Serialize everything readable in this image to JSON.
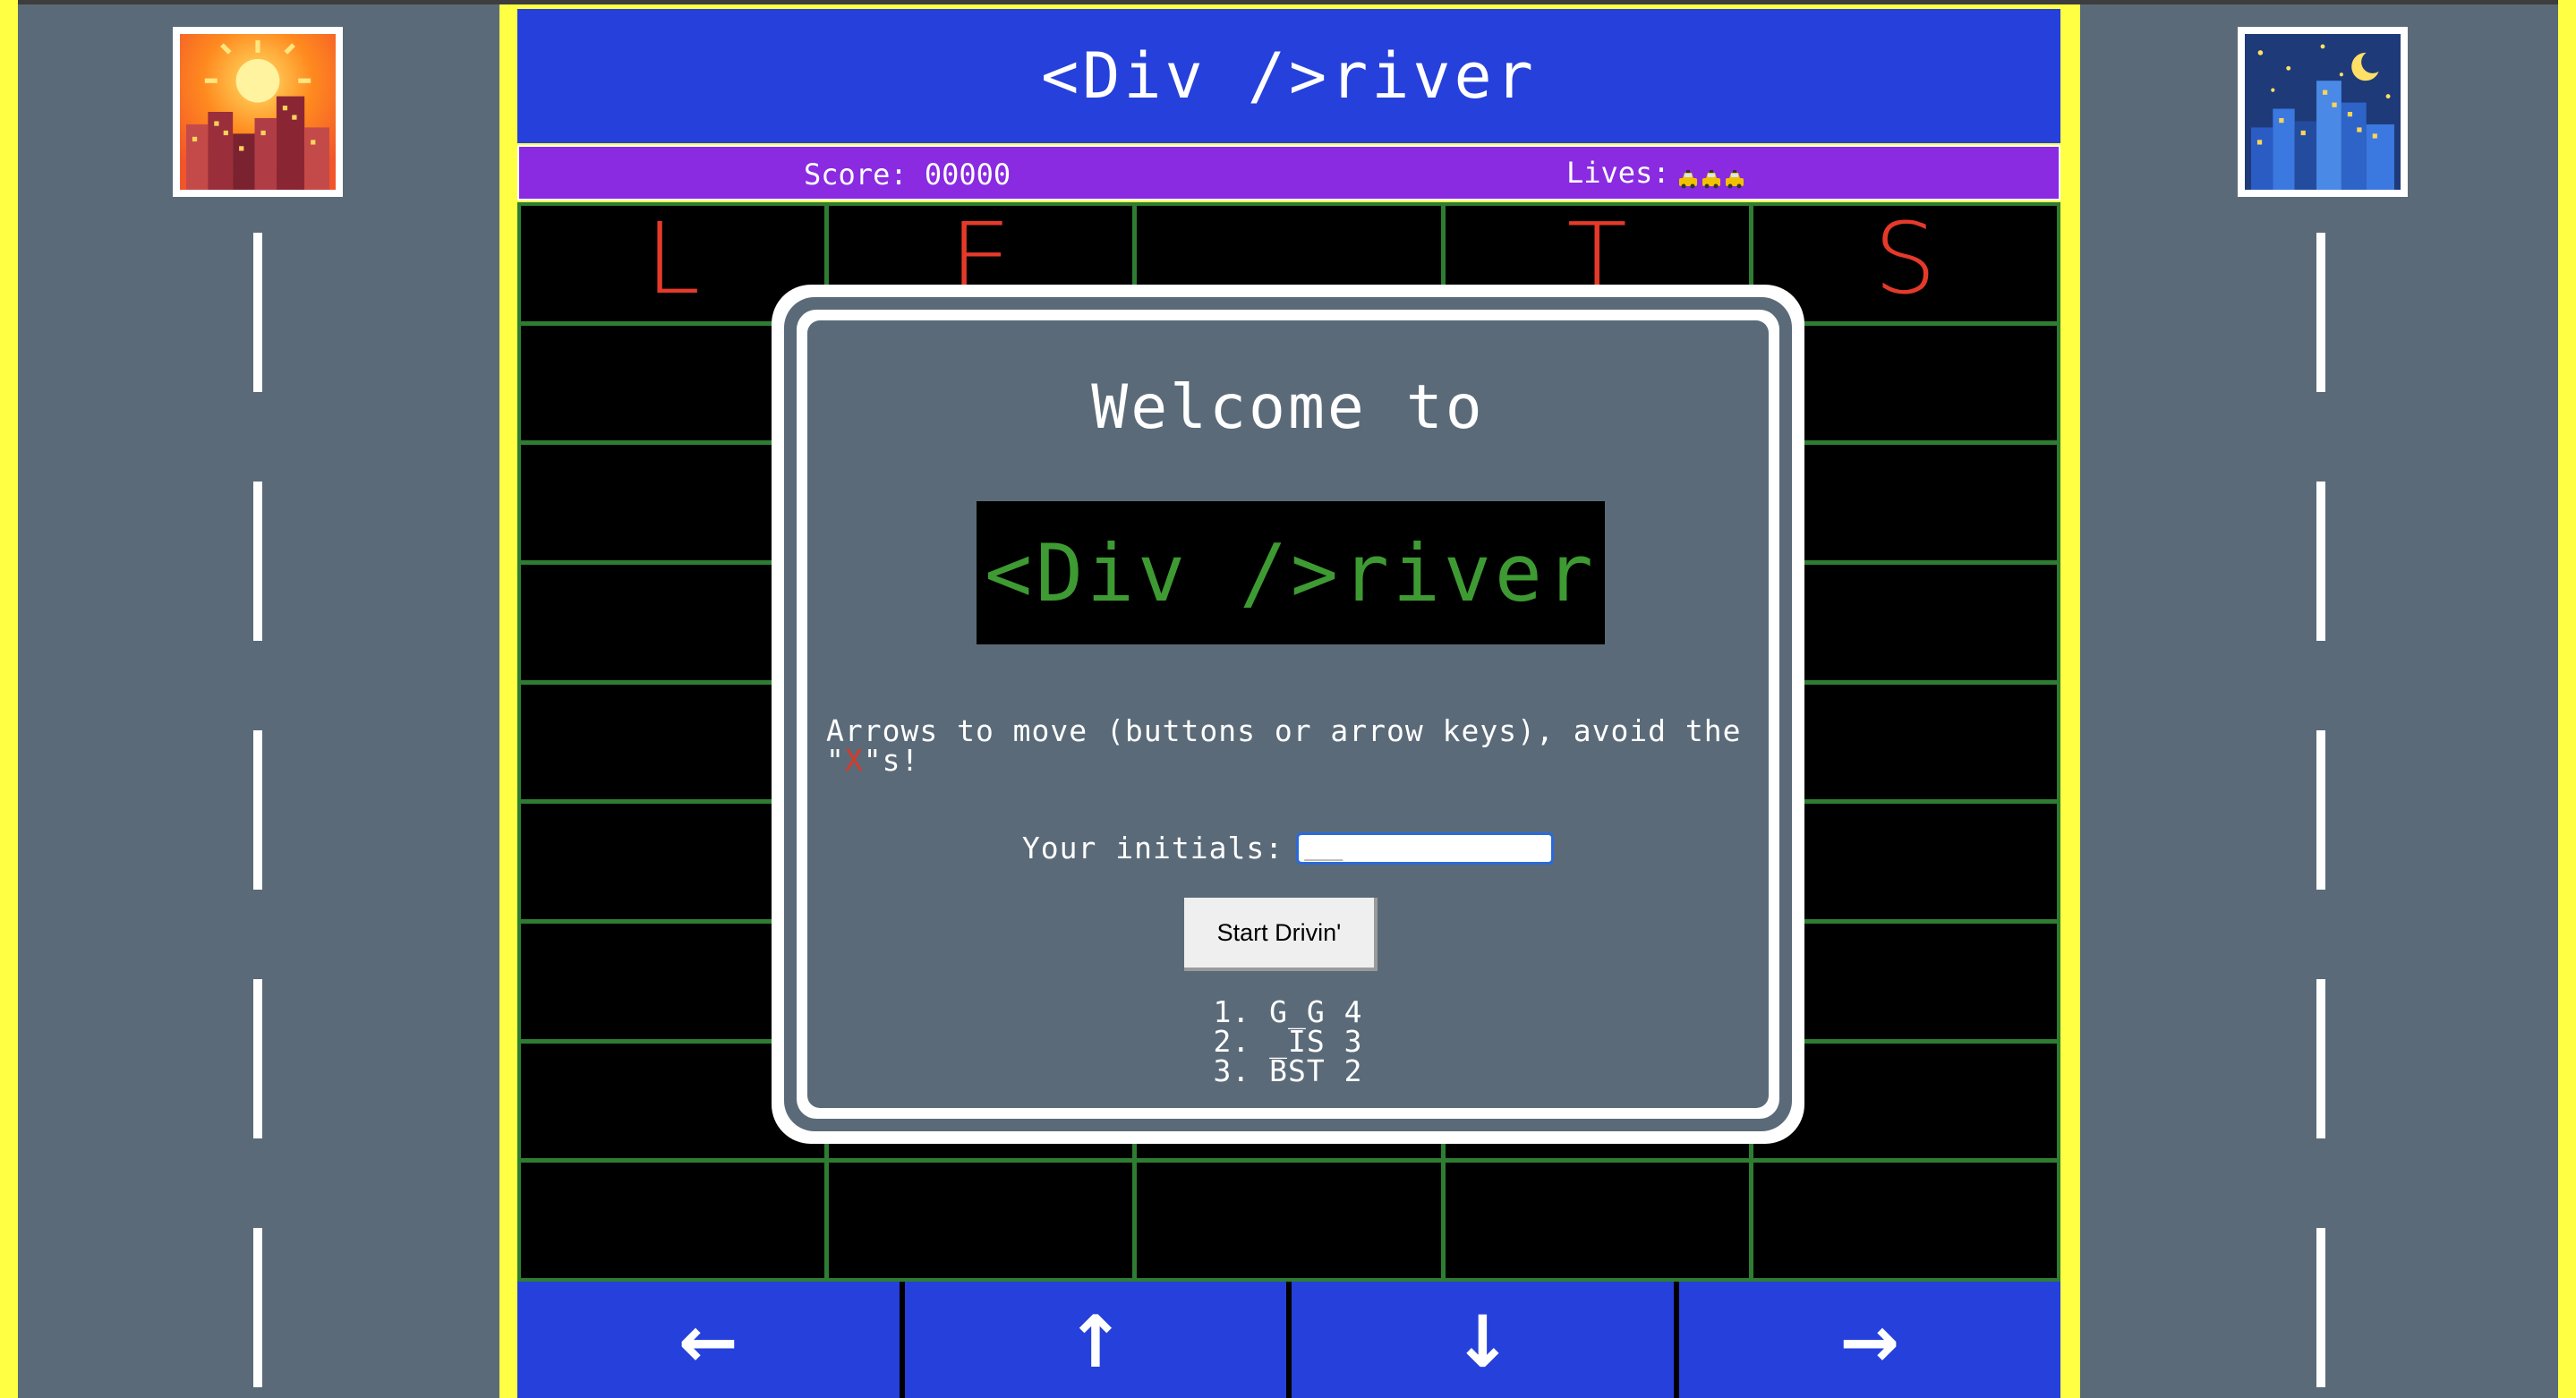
{
  "header": {
    "title": "<Div />river",
    "score_label": "Score: 00000",
    "lives_label": "Lives:",
    "lives_count": 3,
    "lives_icon": "taxi-icon"
  },
  "side": {
    "left_icon": "sunset-city-icon",
    "right_icon": "night-city-icon"
  },
  "grid": {
    "rows": 9,
    "cols": 5,
    "top_letters": [
      "L",
      "E",
      "",
      "T",
      "S"
    ]
  },
  "controls": [
    {
      "id": "left",
      "glyph": "←",
      "icon": "arrow-left-icon"
    },
    {
      "id": "up",
      "glyph": "↑",
      "icon": "arrow-up-icon"
    },
    {
      "id": "down",
      "glyph": "↓",
      "icon": "arrow-down-icon"
    },
    {
      "id": "right",
      "glyph": "→",
      "icon": "arrow-right-icon"
    }
  ],
  "modal": {
    "welcome": "Welcome to",
    "logo": "<Div />river",
    "instructions_pre": "Arrows to move (buttons or arrow keys), avoid the \"",
    "instructions_x": "X",
    "instructions_post": "\"s!",
    "initials_label": "Your initials:",
    "initials_placeholder": "___",
    "initials_value": "",
    "start_label": "Start Drivin'",
    "high_scores": [
      "1. G_G 4",
      "2. _IS 3",
      "3. BST 2"
    ]
  },
  "colors": {
    "title_bar": "#2640db",
    "status_bar": "#8a2be2",
    "road": "#5a6a78",
    "road_edge": "#ffff44",
    "grid_line": "#2e7d32",
    "letter": "#e53a2a",
    "logo_text": "#3e9a32"
  }
}
